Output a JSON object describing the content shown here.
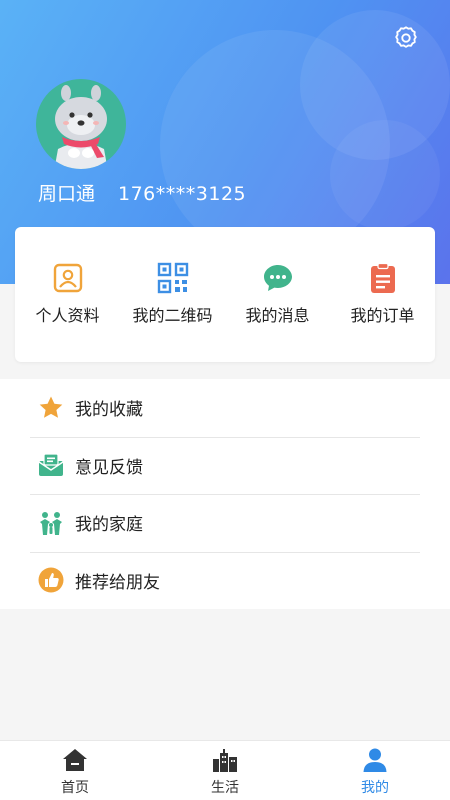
{
  "header": {
    "user_name": "周口通",
    "phone": "176****3125"
  },
  "quick_actions": [
    {
      "label": "个人资料",
      "icon": "profile-card-icon",
      "color": "#f0a43a"
    },
    {
      "label": "我的二维码",
      "icon": "qr-code-icon",
      "color": "#3d8fe4"
    },
    {
      "label": "我的消息",
      "icon": "message-bubble-icon",
      "color": "#41b48c"
    },
    {
      "label": "我的订单",
      "icon": "order-clipboard-icon",
      "color": "#ec6a50"
    }
  ],
  "menu": [
    {
      "label": "我的收藏",
      "icon": "star-icon",
      "color": "#f0a43a"
    },
    {
      "label": "意见反馈",
      "icon": "feedback-mail-icon",
      "color": "#41b48c"
    },
    {
      "label": "我的家庭",
      "icon": "family-icon",
      "color": "#41b48c"
    },
    {
      "label": "推荐给朋友",
      "icon": "thumbs-up-icon",
      "color": "#f0a43a"
    }
  ],
  "tabbar": {
    "items": [
      {
        "label": "首页",
        "icon": "home-icon"
      },
      {
        "label": "生活",
        "icon": "city-buildings-icon"
      },
      {
        "label": "我的",
        "icon": "user-icon",
        "active": true
      }
    ],
    "active_color": "#2f8ae6"
  }
}
